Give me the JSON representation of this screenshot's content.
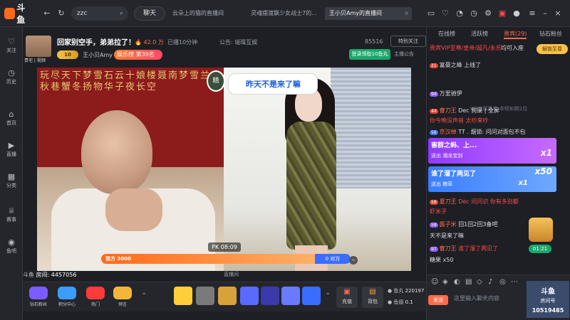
{
  "app": {
    "name": "斗鱼",
    "search_value": "zzc",
    "chat_button": "聊天"
  },
  "tabs": [
    {
      "label": "云朵上的猫的直播间"
    },
    {
      "label": "灵魂摆渡飘少女战士7的..."
    },
    {
      "label": "王小贝Amy的直播间",
      "active": true
    }
  ],
  "sidebar": [
    {
      "label": "关注",
      "icon": "heart-icon"
    },
    {
      "label": "历史",
      "icon": "clock-icon"
    },
    {
      "label": "首页",
      "icon": "home-icon"
    },
    {
      "label": "直播",
      "icon": "live-icon"
    },
    {
      "label": "分类",
      "icon": "grid-icon"
    },
    {
      "label": "赛事",
      "icon": "trophy-icon"
    },
    {
      "label": "鱼吧",
      "icon": "fish-icon"
    }
  ],
  "room": {
    "title": "回家别空手，弟弟拉了！",
    "heat": "42.0 万",
    "duration": "已播10分钟",
    "notice": "公告: 璀璨互娱",
    "avatar_label": "贵宅 | 视频",
    "streamer": "王小贝Amy",
    "level": "10",
    "rank": "娱乐榜 第39名",
    "follow_count": "85516",
    "special_follow": "特别关注",
    "login_label": "登录领取10鱼丸",
    "announce": "主播公告",
    "room_id_label": "斗鱼",
    "room_id": "房间: 4457056",
    "watermark": "直播间"
  },
  "video": {
    "banner_chars": "玩尽天下梦雪石云十娘楼聂南梦雪兰秋巷蟹冬扬物华子夜长空",
    "speech": "昨天不是来了嘛",
    "speech_badge": "精",
    "pk_left": "我方 3000",
    "pk_right": "0 对方",
    "pk_timer": "PK 08:09"
  },
  "gifts": {
    "left": [
      {
        "label": "钻石粉丝",
        "color": "#7b5cff"
      },
      {
        "label": "积分中心",
        "color": "#3a9dff"
      },
      {
        "label": "热门",
        "color": "#ff3a3a"
      },
      {
        "label": "预言",
        "color": "#f3b63a"
      }
    ],
    "items": [
      "#ffce3a",
      "#7a7a7a",
      "#d9a13a",
      "#5a6aff",
      "#3a3aaa",
      "#6a7aff",
      "#3a6dff"
    ],
    "recharge": "充值",
    "bag": "背包",
    "fish_ball_label": "鱼丸",
    "fish_ball": "220197",
    "fish_wing_label": "鱼翅",
    "fish_wing": "0.1"
  },
  "panel": {
    "tabs": [
      "在线榜",
      "活跃榜",
      "贵宾(29)",
      "钻石粉丝"
    ],
    "noble_rank": "贵宾VIP至尊/皇帝/超凡/永乐",
    "noble_tip": "均可入座",
    "unlock": "解锁至尊",
    "vip_tip": "VIP专属推位 本榜如期1位",
    "messages": [
      {
        "lv": "21",
        "name": "富豪之峰",
        "text": "富豪之峰 上线了"
      },
      {
        "lv": "94",
        "name": "",
        "text": "万里驰伊"
      },
      {
        "lv": "44",
        "name": "曹刀王",
        "text": "Dec 狗屎 | 全屏"
      },
      {
        "lv": "",
        "name": "",
        "text": "你今晚没声音 太吵来吵"
      },
      {
        "lv": "58",
        "name": "京汉棹",
        "text": "TT . 烟锁: 问问对面包不包"
      },
      {
        "lv": "58",
        "name": "夏刀王",
        "text": "Dec 问问识 你有多别都"
      },
      {
        "lv": "",
        "name": "",
        "text": "虾米子"
      },
      {
        "lv": "58",
        "name": "露子米",
        "text": "回1回2回3备吧"
      },
      {
        "lv": "",
        "name": "",
        "text": "天不是来了嘛"
      },
      {
        "lv": "97",
        "name": "曹刀王",
        "text": "谁了溜了两见了"
      },
      {
        "lv": "",
        "name": "",
        "text": "糖果 x50"
      }
    ],
    "banners": [
      {
        "title": "害群之蚂、上...",
        "sub1": "送出 湘龙宝剑",
        "count": "x1",
        "color": "#8f3aff"
      },
      {
        "title": "谁了溜了两见了",
        "sub1": "送出 粮草",
        "count": "x50",
        "sub2": "x1",
        "color": "#3a7dff"
      }
    ],
    "input_placeholder": "这里输入聊天内容",
    "send": "发送",
    "viewer_card": {
      "line1": "斗鱼",
      "line2": "房间号",
      "line3": "10519485"
    },
    "timer": "01:21"
  }
}
